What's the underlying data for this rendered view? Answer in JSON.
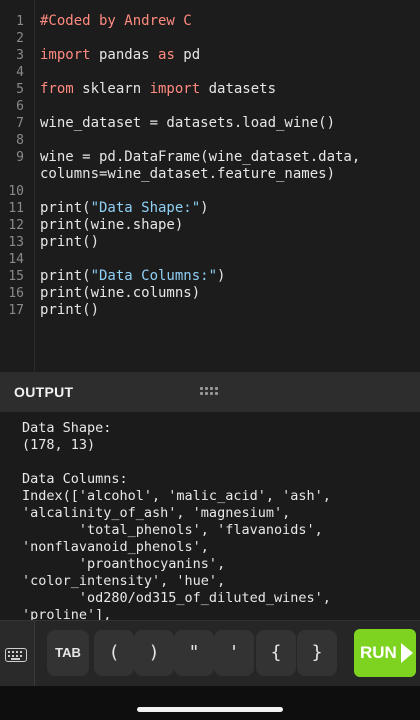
{
  "editor": {
    "lines": [
      {
        "n": "1",
        "parts": [
          {
            "t": "#Coded by Andrew C",
            "c": "cm"
          }
        ]
      },
      {
        "n": "2",
        "parts": []
      },
      {
        "n": "3",
        "parts": [
          {
            "t": "import",
            "c": "kw"
          },
          {
            "t": " pandas "
          },
          {
            "t": "as",
            "c": "kw"
          },
          {
            "t": " pd"
          }
        ]
      },
      {
        "n": "4",
        "parts": []
      },
      {
        "n": "5",
        "parts": [
          {
            "t": "from",
            "c": "kw"
          },
          {
            "t": " sklearn "
          },
          {
            "t": "import",
            "c": "kw"
          },
          {
            "t": " datasets"
          }
        ]
      },
      {
        "n": "6",
        "parts": []
      },
      {
        "n": "7",
        "parts": [
          {
            "t": "wine_dataset = datasets.load_wine()"
          }
        ]
      },
      {
        "n": "8",
        "parts": []
      },
      {
        "n": "9",
        "parts": [
          {
            "t": "wine = pd.DataFrame(wine_dataset.data,"
          }
        ]
      },
      {
        "n": "",
        "parts": [
          {
            "t": "columns=wine_dataset.feature_names)"
          }
        ]
      },
      {
        "n": "10",
        "parts": []
      },
      {
        "n": "11",
        "parts": [
          {
            "t": "print("
          },
          {
            "t": "\"Data Shape:\"",
            "c": "str"
          },
          {
            "t": ")"
          }
        ]
      },
      {
        "n": "12",
        "parts": [
          {
            "t": "print(wine.shape)"
          }
        ]
      },
      {
        "n": "13",
        "parts": [
          {
            "t": "print()"
          }
        ]
      },
      {
        "n": "14",
        "parts": []
      },
      {
        "n": "15",
        "parts": [
          {
            "t": "print("
          },
          {
            "t": "\"Data Columns:\"",
            "c": "str"
          },
          {
            "t": ")"
          }
        ]
      },
      {
        "n": "16",
        "parts": [
          {
            "t": "print(wine.columns)"
          }
        ]
      },
      {
        "n": "17",
        "parts": [
          {
            "t": "print()"
          }
        ]
      }
    ]
  },
  "output": {
    "title": "OUTPUT",
    "text": "Data Shape:\n(178, 13)\n\nData Columns:\nIndex(['alcohol', 'malic_acid', 'ash',\n'alcalinity_of_ash', 'magnesium',\n       'total_phenols', 'flavanoids',\n'nonflavanoid_phenols',\n       'proanthocyanins',\n'color_intensity', 'hue',\n       'od280/od315_of_diluted_wines',\n'proline'],"
  },
  "toolbar": {
    "keyboard_icon": "keyboard-icon",
    "keys": [
      "TAB",
      "(",
      ")",
      "\"",
      "'",
      "{",
      "}"
    ],
    "run_label": "RUN",
    "run_icon": "play-icon",
    "run_color": "#7ed321"
  }
}
